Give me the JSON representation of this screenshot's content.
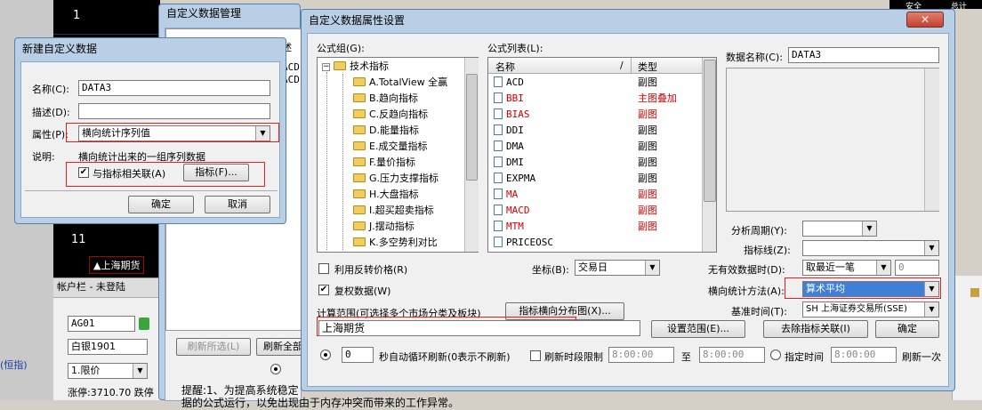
{
  "background": {
    "row_numbers": [
      "1",
      "11"
    ],
    "market_tab": "▲上海期货",
    "account_label": "帐户栏 - 未登陆",
    "code_value": "AG01",
    "name_value": "白银1901",
    "order_type": "1.限价",
    "limit_text": "涨停:3710.70 跌停",
    "side_text": "(恒指)",
    "refresh_selected": "刷新所选(L)",
    "refresh_all": "刷新全部",
    "notice": "提醒:1、为提高系统稳定",
    "notice2": "据的公式运行，以免出现由于内存冲突而带来的工作异常。",
    "top_right_1": "安全",
    "top_right_2": "总计"
  },
  "manage_window": {
    "title": "自定义数据管理",
    "col_partial": "述",
    "rows": [
      "ACD",
      "ACD"
    ]
  },
  "new_dialog": {
    "title": "新建自定义数据",
    "name_label": "名称(C):",
    "name_value": "DATA3",
    "desc_label": "描述(D):",
    "desc_value": "",
    "attr_label": "属性(P):",
    "attr_value": "横向统计序列值",
    "note_label": "说明:",
    "note_text": "横向统计出来的一组序列数据",
    "link_label": "与指标相关联(A)",
    "link_checked": "✔",
    "indicator_button": "指标(F)...",
    "ok_button": "确定",
    "cancel_button": "取消"
  },
  "props_dialog": {
    "title": "自定义数据属性设置",
    "close": "✕",
    "formula_group_label": "公式组(G):",
    "tree_root": "技术指标",
    "tree_toggle": "−",
    "tree_items": [
      "A.TotalView 全",
      "B.趋向指标",
      "C.反趋向指标",
      "D.能量指标",
      "E.成交量指标",
      "F.量价指标",
      "G.压力支撑指标",
      "H.大盘指标",
      "I.超买超卖指标",
      "J.摆动指标",
      "K.多空势利对比"
    ],
    "tree_item_extra": "赢",
    "formula_list_label": "公式列表(L):",
    "list_headers": {
      "name": "名称",
      "slash": "/",
      "type": "类型"
    },
    "formulas": [
      {
        "name": "ACD",
        "type": "副图",
        "red": false
      },
      {
        "name": "BBI",
        "type": "主图叠加",
        "red": true
      },
      {
        "name": "BIAS",
        "type": "副图",
        "red": true
      },
      {
        "name": "DDI",
        "type": "副图",
        "red": false
      },
      {
        "name": "DMA",
        "type": "副图",
        "red": false
      },
      {
        "name": "DMI",
        "type": "副图",
        "red": false
      },
      {
        "name": "EXPMA",
        "type": "副图",
        "red": false
      },
      {
        "name": "MA",
        "type": "副图",
        "red": true
      },
      {
        "name": "MACD",
        "type": "副图",
        "red": true
      },
      {
        "name": "MTM",
        "type": "副图",
        "red": true
      },
      {
        "name": "PRICEOSC",
        "type": "",
        "red": false
      }
    ],
    "data_name_label": "数据名称(C):",
    "data_name_value": "DATA3",
    "period_label": "分析周期(Y):",
    "period_value": "",
    "indicator_line_label": "指标线(Z):",
    "indicator_line_value": "",
    "reverse_price_label": "利用反转价格(R)",
    "coord_label": "坐标(B):",
    "coord_value": "交易日",
    "invalid_label": "无有效数据时(D):",
    "invalid_value": "取最近一笔",
    "invalid_num": "0",
    "restore_label": "复权数据(W)",
    "restore_checked": "✔",
    "calc_method_label": "横向统计方法(A):",
    "calc_method_value": "算术平均",
    "calc_range_label": "计算范围(可选择多个市场分类及板块)",
    "distribution_button": "指标横向分布图(X)...",
    "base_time_label": "基准时间(T):",
    "base_time_value": "SH 上海证券交易所(SSE)",
    "range_value": "上海期货",
    "set_range_button": "设置范围(E)...",
    "remove_link_button": "去除指标关联(I)",
    "ok_button": "确定",
    "auto_value": "0",
    "auto_label": "秒自动循环刷新(0表示不刷新)",
    "period_limit_label": "刷新时段限制",
    "time_start": "8:00:00",
    "to_label": "至",
    "time_end": "8:00:00",
    "fixed_time_label": "指定时间",
    "time_fixed": "8:00:00",
    "refresh_once_label": "刷新一次"
  }
}
